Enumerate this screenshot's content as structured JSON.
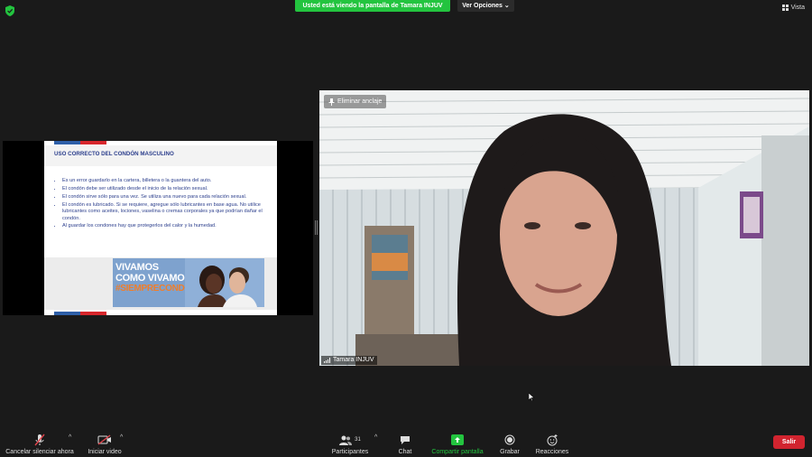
{
  "top": {
    "share_banner": "Usted está viendo la pantalla de Tamara INJUV",
    "view_options": "Ver Opciones",
    "view_options_caret": "⌄",
    "vista": "Vista"
  },
  "slide": {
    "title": "USO CORRECTO DEL CONDÓN MASCULINO",
    "bullets": [
      "Es un error guardarlo en la cartera, billetera o la guantera del auto.",
      "El condón debe ser utilizado desde el inicio de la relación sexual.",
      "El condón sirve sólo para una vez. Se utiliza una nuevo para cada relación sexual.",
      "El condón es lubricado. Si se requiere, agregue sólo lubricantes en base agua. No utilice lubricantes como aceites, lociones, vaselina o cremas corporales ya que podrían dañar el condón.",
      "Al guardar los condones hay que protegerlos del calor y la humedad."
    ],
    "campaign_line1": "VIVAMOS",
    "campaign_line2": "COMO VIVAMOS",
    "campaign_tag": "#SIEMPRECONDON"
  },
  "video": {
    "unpin_label": "Eliminar anclaje",
    "participant_name": "Tamara INJUV"
  },
  "toolbar": {
    "mute_label": "Cancelar silenciar ahora",
    "video_label": "Iniciar video",
    "participants_label": "Participantes",
    "participants_count": "31",
    "chat_label": "Chat",
    "share_label": "Compartir pantalla",
    "record_label": "Grabar",
    "reactions_label": "Reacciones",
    "leave_label": "Salir",
    "caret": "^"
  },
  "colors": {
    "share_green": "#23c43f",
    "leave_red": "#d1242f",
    "slide_blue": "#2b3e8c",
    "campaign_orange": "#f07e2b"
  }
}
